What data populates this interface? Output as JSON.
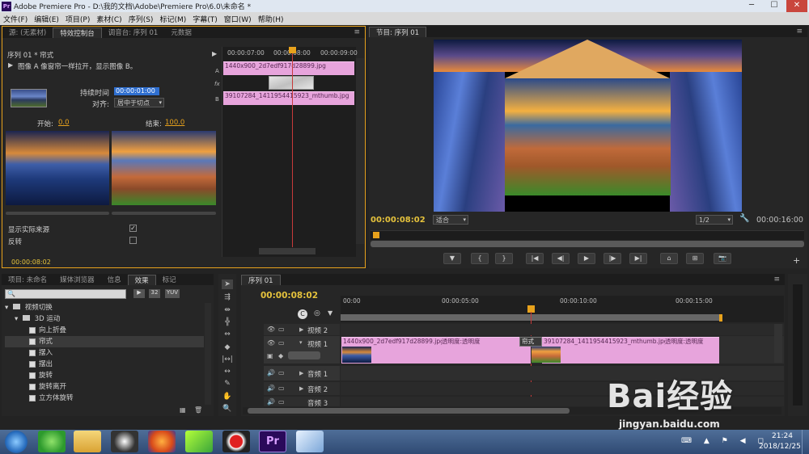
{
  "window": {
    "title": "Adobe Premiere Pro - D:\\我的文档\\Adobe\\Premiere Pro\\6.0\\未命名 *",
    "app_icon": "Pr"
  },
  "menu": [
    "文件(F)",
    "编辑(E)",
    "项目(P)",
    "素材(C)",
    "序列(S)",
    "标记(M)",
    "字幕(T)",
    "窗口(W)",
    "帮助(H)"
  ],
  "top_left_tabs": [
    "源: (无素材)",
    "特效控制台",
    "调音台: 序列 01",
    "元数据"
  ],
  "effect_controls": {
    "header": "序列 01 * 帘式",
    "description": "图像 A 像窗帘一样拉开，显示图像 B。",
    "duration_label": "持续时间",
    "duration_value": "00:00:01:00",
    "align_label": "对齐:",
    "align_value": "居中于切点",
    "start_label": "开始:",
    "start_value": "0.0",
    "end_label": "结束:",
    "end_value": "100.0",
    "show_source_label": "显示实际来源",
    "reverse_label": "反转",
    "ruler_t1": "00:00:07:00",
    "ruler_t2": "00:00:08:00",
    "ruler_t3": "00:00:09:00",
    "clip_a": "1440x900_2d7edf917d28899.jpg",
    "clip_b": "39107284_1411954415923_mthumb.jpg",
    "track_a": "A",
    "track_fx": "fx",
    "track_b": "B",
    "current_time": "00:00:08:02"
  },
  "program": {
    "tab": "节目: 序列 01",
    "timecode": "00:00:08:02",
    "fit": "适合",
    "ratio": "1/2",
    "duration": "00:00:16:00"
  },
  "project_tabs": [
    "项目: 未命名",
    "媒体浏览器",
    "信息",
    "效果",
    "标记"
  ],
  "effects_tree": {
    "folder": "视频切换",
    "subfolder": "3D 运动",
    "items": [
      "向上折叠",
      "帘式",
      "摆入",
      "摆出",
      "旋转",
      "旋转离开",
      "立方体旋转"
    ],
    "selected_index": 1,
    "icon_32": "32",
    "icon_yuv": "YUV"
  },
  "timeline": {
    "tab": "序列 01",
    "timecode": "00:00:08:02",
    "ruler": [
      "00:00",
      "00:00:05:00",
      "00:00:10:00",
      "00:00:15:00"
    ],
    "tracks": {
      "video2": "视频 2",
      "video1": "视频 1",
      "audio1": "音频 1",
      "audio2": "音频 2",
      "audio3": "音频 3"
    },
    "clip1": "1440x900_2d7edf917d28899.jpg",
    "clip1_fx": "透明度:透明度",
    "transition": "帘式",
    "clip2": "39107284_1411954415923_mthumb.jpg",
    "clip2_fx": "透明度:透明度"
  },
  "watermark": {
    "brand": "Bai经验",
    "url": "jingyan.baidu.com"
  },
  "taskbar": {
    "time": "21:24",
    "date": "2018/12/25",
    "pr_label": "Pr"
  },
  "colors": {
    "accent": "#e8a21c",
    "clip": "#e7a4dc",
    "playhead": "#c83a3a"
  }
}
